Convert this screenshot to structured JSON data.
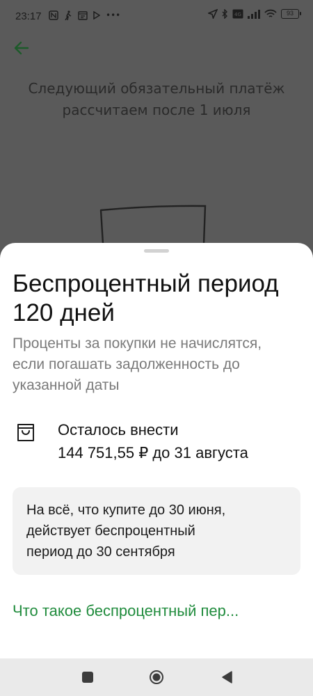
{
  "status_bar": {
    "time": "23:17",
    "battery": "93",
    "left_icons": [
      "nfc-icon",
      "walk-icon",
      "calendar-icon",
      "play-icon",
      "more-icon"
    ],
    "right_icons": [
      "location-icon",
      "bluetooth-icon",
      "volte-icon",
      "signal-icon",
      "wifi-icon"
    ]
  },
  "background": {
    "heading_line1": "Следующий обязательный платёж",
    "heading_line2": "рассчитаем после 1 июля"
  },
  "sheet": {
    "title_line1": "Беспроцентный период",
    "title_line2": "120 дней",
    "desc_line1": "Проценты за покупки не начислятся,",
    "desc_line2": "если погашать задолженность до",
    "desc_line3": "указанной даты",
    "remaining_label": "Осталось внести",
    "remaining_value": "144 751,55 ₽ до 31 августа",
    "promo_line1": "На всё, что купите до 30 июня,",
    "promo_line2": "действует беспроцентный",
    "promo_line3": "период до 30 сентября",
    "link_text": "Что такое беспроцентный пер..."
  },
  "colors": {
    "accent_green": "#1f8b3c",
    "overlay": "#5a5a5a",
    "card_bg": "#f2f2f2"
  }
}
